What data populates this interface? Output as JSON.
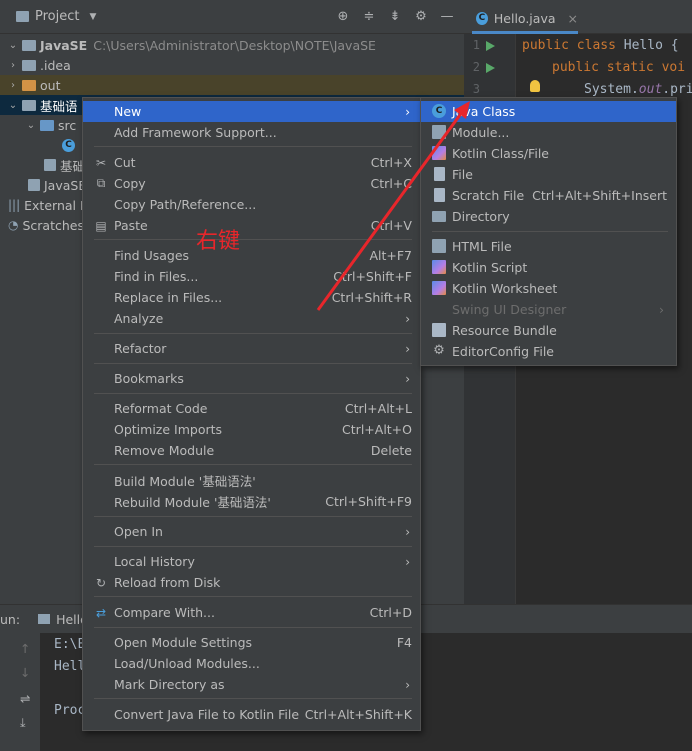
{
  "project_toolbar": {
    "title": "Project"
  },
  "editor_tab": {
    "label": "Hello.java",
    "close": "×"
  },
  "tree": {
    "root_name": "JavaSE",
    "root_path": "C:\\Users\\Administrator\\Desktop\\NOTE\\JavaSE",
    "idea": ".idea",
    "out": "out",
    "module": "基础语",
    "src": "src",
    "module_file": "基础",
    "iml": "JavaSE",
    "external": "External L",
    "scratches": "Scratches"
  },
  "editor": {
    "lines": [
      "1",
      "2",
      "3"
    ],
    "line1_kw1": "public",
    "line1_kw2": "class",
    "line1_name": "Hello {",
    "line2_kw1": "public",
    "line2_kw2": "static",
    "line2_kw3": "voi",
    "line3_pre": "System.",
    "line3_fld": "out",
    "line3_post": ".pri"
  },
  "run_panel": {
    "label": "un:",
    "tab": "Hello",
    "out1": "E:\\E",
    "out2": "Hell",
    "out3": "Proc"
  },
  "context_menu": {
    "new": "New",
    "add_framework": "Add Framework Support...",
    "cut": "Cut",
    "cut_sc": "Ctrl+X",
    "copy": "Copy",
    "copy_sc": "Ctrl+C",
    "copy_path": "Copy Path/Reference...",
    "paste": "Paste",
    "paste_sc": "Ctrl+V",
    "find_usages": "Find Usages",
    "find_usages_sc": "Alt+F7",
    "find_in_files": "Find in Files...",
    "find_in_files_sc": "Ctrl+Shift+F",
    "replace_in_files": "Replace in Files...",
    "replace_in_files_sc": "Ctrl+Shift+R",
    "analyze": "Analyze",
    "refactor": "Refactor",
    "bookmarks": "Bookmarks",
    "reformat": "Reformat Code",
    "reformat_sc": "Ctrl+Alt+L",
    "optimize": "Optimize Imports",
    "optimize_sc": "Ctrl+Alt+O",
    "remove_module": "Remove Module",
    "remove_module_sc": "Delete",
    "build_module": "Build Module '基础语法'",
    "rebuild_module": "Rebuild Module '基础语法'",
    "rebuild_module_sc": "Ctrl+Shift+F9",
    "open_in": "Open In",
    "local_history": "Local History",
    "reload": "Reload from Disk",
    "compare": "Compare With...",
    "compare_sc": "Ctrl+D",
    "open_module_settings": "Open Module Settings",
    "open_module_settings_sc": "F4",
    "load_unload": "Load/Unload Modules...",
    "mark_directory": "Mark Directory as",
    "convert": "Convert Java File to Kotlin File",
    "convert_sc": "Ctrl+Alt+Shift+K"
  },
  "submenu": {
    "java_class": "Java Class",
    "module": "Module...",
    "kotlin_class": "Kotlin Class/File",
    "file": "File",
    "scratch": "Scratch File",
    "scratch_sc": "Ctrl+Alt+Shift+Insert",
    "directory": "Directory",
    "html": "HTML File",
    "kotlin_script": "Kotlin Script",
    "kotlin_worksheet": "Kotlin Worksheet",
    "swing": "Swing UI Designer",
    "resource_bundle": "Resource Bundle",
    "editorconfig": "EditorConfig File"
  },
  "annotation": {
    "text": "右键"
  },
  "colors": {
    "highlight": "#2f65ca",
    "annotation": "#e8262b",
    "menu_bg": "#3c3f41"
  }
}
